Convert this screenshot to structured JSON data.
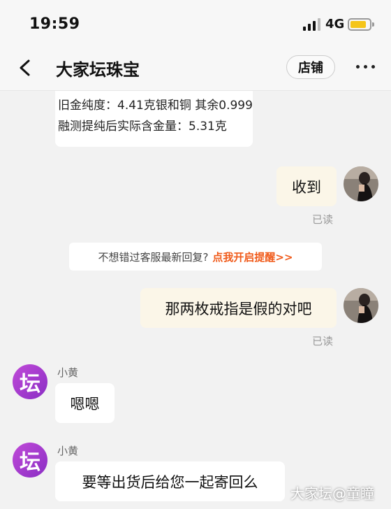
{
  "status_bar": {
    "time": "19:59",
    "network": "4G"
  },
  "header": {
    "title": "大家坛珠宝",
    "shop_button": "店铺"
  },
  "messages": {
    "top_bubble": {
      "line1": "旧金纯度：4.41克银和铜 其余0.999",
      "line2": "融测提纯后实际含金量：5.31克"
    },
    "msg1": {
      "text": "收到",
      "read": "已读"
    },
    "notice": {
      "text": "不想错过客服最新回复?",
      "link": "点我开启提醒>>"
    },
    "msg2": {
      "text": "那两枚戒指是假的对吧",
      "read": "已读"
    },
    "msg3": {
      "sender": "小黄",
      "avatar_text": "坛",
      "text": "嗯嗯"
    },
    "msg4": {
      "sender": "小黄",
      "avatar_text": "坛",
      "text": "要等出货后给您一起寄回么"
    }
  },
  "watermark": "大家坛@童瞳"
}
